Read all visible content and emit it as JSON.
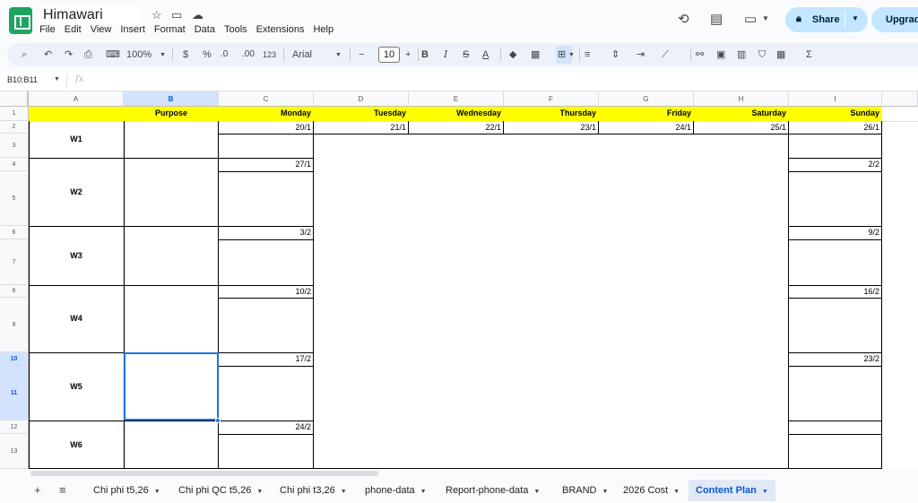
{
  "app": {
    "title": "Himawari",
    "menu": [
      "File",
      "Edit",
      "View",
      "Insert",
      "Format",
      "Data",
      "Tools",
      "Extensions",
      "Help"
    ],
    "share_label": "Share",
    "upgrade_label": "Upgrad"
  },
  "toolbar": {
    "zoom": "100%",
    "currency": "$",
    "percent": "%",
    "dec_decrease": ".0",
    "dec_increase": ".00",
    "number_format": "123",
    "font": "Arial",
    "font_size": "10"
  },
  "formula_bar": {
    "name_box": "B10:B11",
    "fx_label": "fx"
  },
  "grid": {
    "columns": [
      "A",
      "B",
      "C",
      "D",
      "E",
      "F",
      "G",
      "H",
      "I"
    ],
    "selected_column": "B",
    "rows": [
      "1",
      "2",
      "3",
      "4",
      "5",
      "6",
      "7",
      "8",
      "9",
      "10",
      "11",
      "12",
      "13"
    ],
    "selected_rows": [
      "10",
      "11"
    ],
    "header": {
      "purpose": "Purpose",
      "days": [
        "Monday",
        "Tuesday",
        "Wednesday",
        "Thursday",
        "Friday",
        "Saturday",
        "Sunday"
      ]
    },
    "weeks": [
      "W1",
      "W2",
      "W3",
      "W4",
      "W5",
      "W6"
    ],
    "week1_dates": [
      "20/1",
      "21/1",
      "22/1",
      "23/1",
      "24/1",
      "25/1",
      "26/1"
    ],
    "monday_dates": [
      "27/1",
      "3/2",
      "10/2",
      "17/2",
      "24/2"
    ],
    "sunday_dates": [
      "2/2",
      "9/2",
      "16/2",
      "23/2"
    ]
  },
  "sheets": {
    "tabs": [
      "Chi phi t5,26",
      "Chi phi QC t5,26",
      "Chi phi t3,26",
      "phone-data",
      "Report-phone-data",
      "BRAND",
      "2026 Cost",
      "Content Plan"
    ],
    "active": "Content Plan"
  },
  "colors": {
    "header_yellow": "#ffff00",
    "selection_blue": "#1a73e8",
    "share_bg": "#c2e7ff",
    "logo_green": "#1fa463"
  }
}
